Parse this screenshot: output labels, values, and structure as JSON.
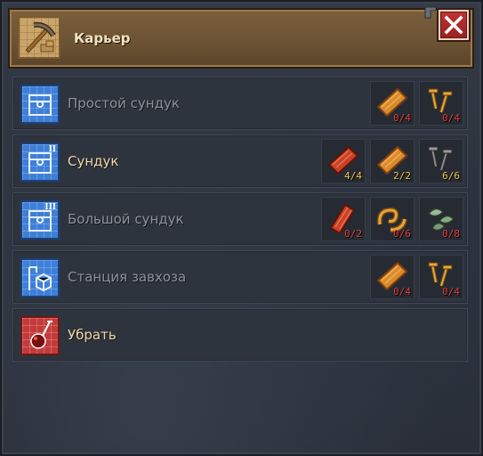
{
  "window": {
    "title": "Карьер",
    "icon": "pickaxe-icon",
    "close_icon": "close-icon"
  },
  "items": [
    {
      "label": "Простой сундук",
      "icon": "chest-icon",
      "available": false,
      "costs": [
        {
          "icon": "plank-icon",
          "count": "0/4",
          "enough": false
        },
        {
          "icon": "nails-icon",
          "count": "0/4",
          "enough": false
        }
      ]
    },
    {
      "label": "Сундук",
      "icon": "chest-icon",
      "tier": "II",
      "available": true,
      "costs": [
        {
          "icon": "red-plank-icon",
          "count": "4/4",
          "enough": true
        },
        {
          "icon": "plank-icon",
          "count": "2/2",
          "enough": true
        },
        {
          "icon": "iron-nails-icon",
          "count": "6/6",
          "enough": true
        }
      ]
    },
    {
      "label": "Большой сундук",
      "icon": "chest-icon",
      "tier": "III",
      "available": false,
      "costs": [
        {
          "icon": "red-plank-icon",
          "count": "0/2",
          "enough": false
        },
        {
          "icon": "carved-ornament-icon",
          "count": "0/6",
          "enough": false
        },
        {
          "icon": "leaves-icon",
          "count": "0/8",
          "enough": false
        }
      ]
    },
    {
      "label": "Станция завхоза",
      "icon": "station-icon",
      "available": false,
      "costs": [
        {
          "icon": "plank-icon",
          "count": "0/4",
          "enough": false
        },
        {
          "icon": "nails-icon",
          "count": "0/4",
          "enough": false
        }
      ]
    },
    {
      "label": "Убрать",
      "icon": "wrecking-ball-icon",
      "available": true,
      "costs": []
    }
  ],
  "colors": {
    "count_missing": "#e23c3c",
    "count_enough": "#f2c24a",
    "label_active": "#f0d8a4",
    "label_inactive": "#8c929c"
  }
}
